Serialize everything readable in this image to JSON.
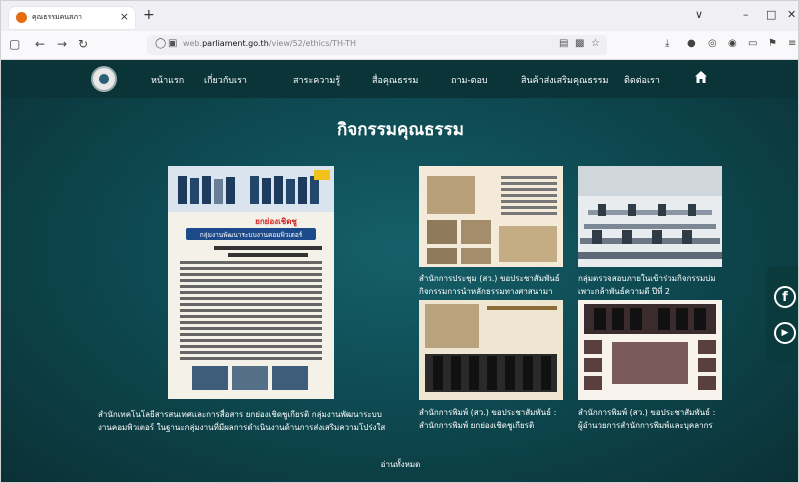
{
  "browser": {
    "tab_title": "คุณธรรมคนสภา",
    "tab_close": "×",
    "new_tab": "+",
    "url_prefix": "web.",
    "url_domain": "parliament.go.th",
    "url_path": "/view/52/ethics/TH-TH",
    "window_controls": [
      "∨",
      "–",
      "□",
      "✕"
    ]
  },
  "site": {
    "nav": [
      "หน้าแรก",
      "เกี่ยวกับเรา",
      "สาระความรู้",
      "สื่อคุณธรรม",
      "ถาม-ตอบ",
      "สินค้าส่งเสริมคุณธรรม",
      "ติดต่อเรา"
    ],
    "heading": "กิจกรรมคุณธรรม",
    "poster_title": "ยกย่องเชิดชู",
    "poster_sub": "กลุ่มงานพัฒนาระบบงานคอมพิวเตอร์",
    "cards": [
      {
        "caption_1": "สำนักเทคโนโลยีสารสนเทศและการสื่อสาร ยกย่องเชิดชูเกียรติ กลุ่มงานพัฒนาระบบ",
        "caption_2": "งานคอมพิวเตอร์ ในฐานะกลุ่มงานที่มีผลการดำเนินงานด้านการส่งเสริมความโปร่งใส"
      },
      {
        "caption_1": "สำนักการประชุม (สว.) ขอประชาสัมพันธ์",
        "caption_2": "กิจกรรมการนำหลักธรรมทางศาสนามา"
      },
      {
        "caption_1": "กลุ่มตรวจสอบภายในเข้าร่วมกิจกรรมบ่ม",
        "caption_2": "เพาะกล้าพันธ์ความดี ปีที่ 2"
      },
      {
        "caption_1": "สำนักการพิมพ์ (สว.) ขอประชาสัมพันธ์ :",
        "caption_2": "สำนักการพิมพ์ ยกย่องเชิดชูเกียรติ"
      },
      {
        "caption_1": "สำนักการพิมพ์ (สว.) ขอประชาสัมพันธ์ :",
        "caption_2": "ผู้อำนวยการสำนักการพิมพ์และบุคลากร"
      }
    ],
    "read_all": "อ่านทั้งหมด",
    "social": [
      "f",
      "▶"
    ]
  }
}
